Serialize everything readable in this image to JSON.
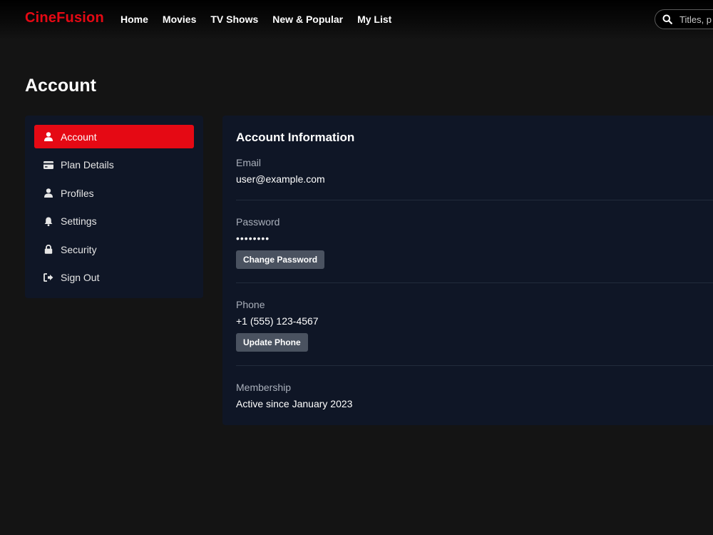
{
  "brand": {
    "name": "CineFusion",
    "accent_color": "#e50914"
  },
  "nav": {
    "items": [
      {
        "label": "Home"
      },
      {
        "label": "Movies"
      },
      {
        "label": "TV Shows"
      },
      {
        "label": "New & Popular"
      },
      {
        "label": "My List"
      }
    ]
  },
  "search": {
    "icon": "search-icon",
    "placeholder": "Titles, p",
    "value": ""
  },
  "page": {
    "title": "Account"
  },
  "sidebar": {
    "items": [
      {
        "label": "Account",
        "icon": "user-icon",
        "active": true
      },
      {
        "label": "Plan Details",
        "icon": "credit-card-icon",
        "active": false
      },
      {
        "label": "Profiles",
        "icon": "user-icon",
        "active": false
      },
      {
        "label": "Settings",
        "icon": "bell-icon",
        "active": false
      },
      {
        "label": "Security",
        "icon": "lock-icon",
        "active": false
      },
      {
        "label": "Sign Out",
        "icon": "sign-out-icon",
        "active": false
      }
    ]
  },
  "account_info": {
    "title": "Account Information",
    "email": {
      "label": "Email",
      "value": "user@example.com"
    },
    "password": {
      "label": "Password",
      "value": "••••••••",
      "button": "Change Password"
    },
    "phone": {
      "label": "Phone",
      "value": "+1 (555) 123-4567",
      "button": "Update Phone"
    },
    "membership": {
      "label": "Membership",
      "value": "Active since January 2023"
    }
  },
  "colors": {
    "background": "#141414",
    "panel": "#0f1626",
    "button": "#4a5260",
    "muted_text": "#a9afba"
  }
}
